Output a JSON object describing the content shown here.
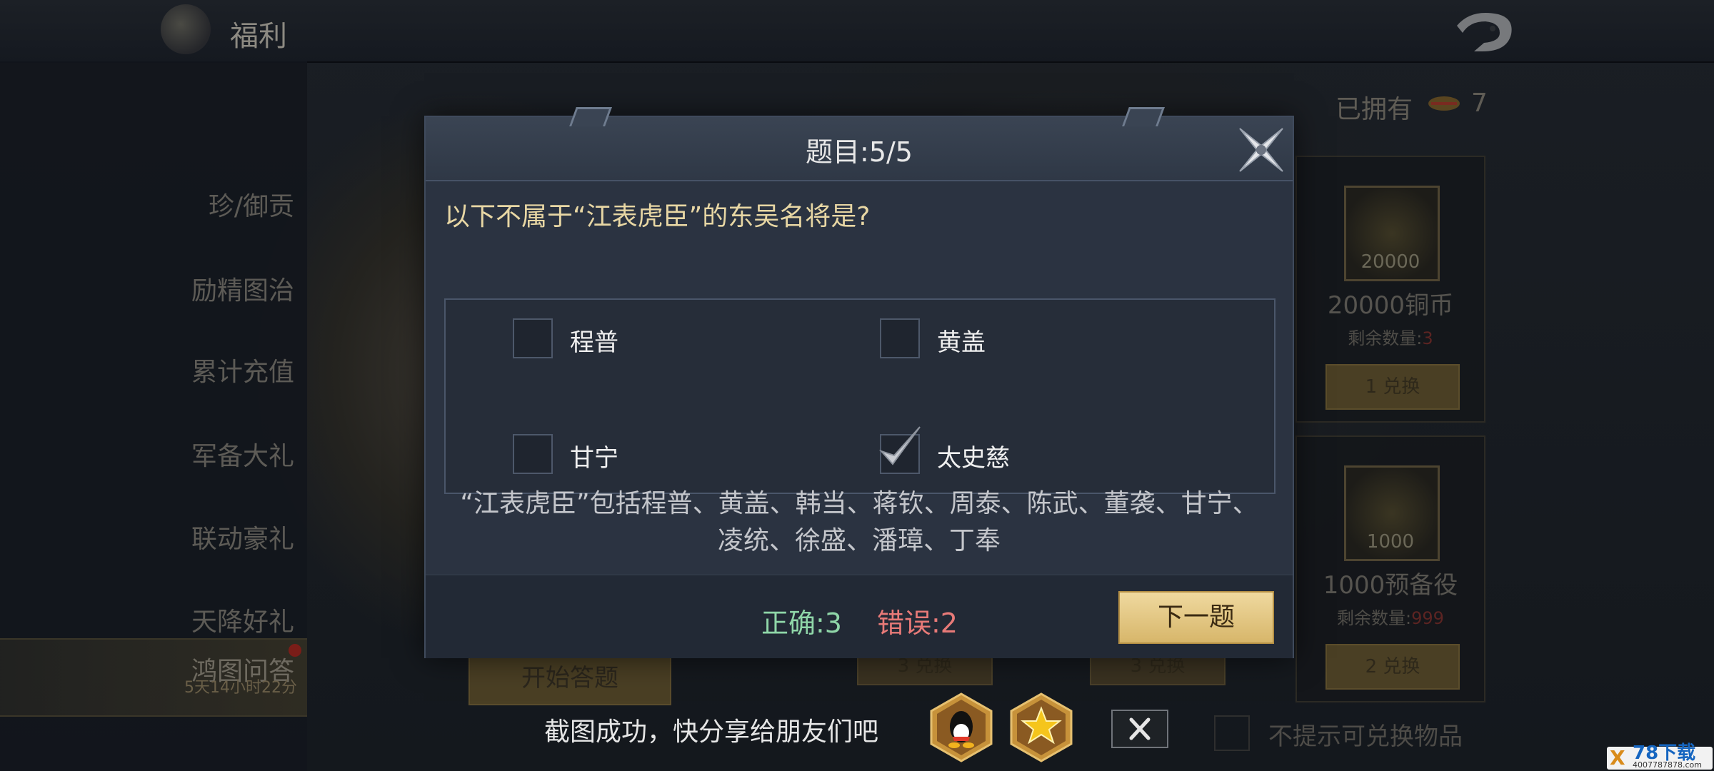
{
  "page": {
    "title": "福利"
  },
  "sidebar": {
    "items": [
      {
        "label": "珍/御贡"
      },
      {
        "label": "励精图治"
      },
      {
        "label": "累计充值"
      },
      {
        "label": "军备大礼"
      },
      {
        "label": "联动豪礼"
      },
      {
        "label": "天降好礼"
      },
      {
        "label": "鸿图问答",
        "countdown": "5天14小时22分",
        "active": true
      }
    ]
  },
  "owned": {
    "label": "已拥有",
    "count": "7",
    "icon": "token-icon"
  },
  "cards": [
    {
      "qty": "20000",
      "name": "20000铜币",
      "remain_label": "剩余数量:",
      "remain_value": "3",
      "cost": "1",
      "btn": "兑换",
      "icon": "coin-icon"
    },
    {
      "qty": "1000",
      "name": "1000预备役",
      "remain_label": "剩余数量:",
      "remain_value": "999",
      "cost": "2",
      "btn": "兑换",
      "icon": "helmet-icon"
    }
  ],
  "bg_buttons": [
    {
      "cost": "3",
      "label": "兑换"
    },
    {
      "cost": "3",
      "label": "兑换"
    }
  ],
  "start_button": "开始答题",
  "no_remind": "不提示可兑换物品",
  "dialog": {
    "title": "题目:5/5",
    "question": "以下不属于“江表虎臣”的东吴名将是?",
    "options": [
      {
        "label": "程普",
        "checked": false
      },
      {
        "label": "黄盖",
        "checked": false
      },
      {
        "label": "甘宁",
        "checked": false
      },
      {
        "label": "太史慈",
        "checked": true
      }
    ],
    "explanation": "“江表虎臣”包括程普、黄盖、韩当、蒋钦、周泰、陈武、董袭、甘宁、凌统、徐盛、潘璋、丁奉",
    "correct": "正确:3",
    "wrong": "错误:2",
    "next_button": "下一题"
  },
  "share": {
    "text": "截图成功，快分享给朋友们吧",
    "buttons": [
      "qq-icon",
      "qzone-icon"
    ]
  },
  "watermark": {
    "mark": "X",
    "text": "78下载",
    "url": "4007787878.com"
  },
  "colors": {
    "gold": "#d7b66a",
    "correct": "#8fd6a8",
    "wrong": "#e87a78",
    "question": "#e8d7a4"
  }
}
